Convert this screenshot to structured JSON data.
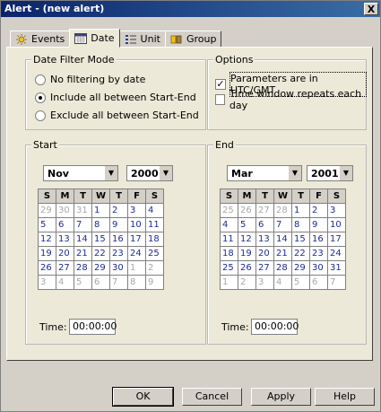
{
  "window": {
    "title": "Alert - (new alert)",
    "close_glyph": "X"
  },
  "tabs": [
    {
      "label": "Events",
      "icon": "events-icon"
    },
    {
      "label": "Date",
      "icon": "calendar-icon"
    },
    {
      "label": "Unit",
      "icon": "unit-icon"
    },
    {
      "label": "Group",
      "icon": "group-icon"
    }
  ],
  "date_filter": {
    "legend": "Date Filter Mode",
    "options": [
      {
        "label": "No filtering by date",
        "checked": false
      },
      {
        "label": "Include all between Start-End",
        "checked": true
      },
      {
        "label": "Exclude all between Start-End",
        "checked": false
      }
    ]
  },
  "options": {
    "legend": "Options",
    "utc": {
      "label": "Parameters are in UTC/GMT",
      "checked": true,
      "mark": "✓"
    },
    "repeat": {
      "label": "Time window repeats each day",
      "checked": false
    }
  },
  "start": {
    "legend": "Start",
    "month": "Nov",
    "year": "2000",
    "time_label": "Time:",
    "time_value": "00:00:00",
    "days_header": [
      "S",
      "M",
      "T",
      "W",
      "T",
      "F",
      "S"
    ],
    "grid": [
      [
        "29",
        "30",
        "31",
        "1",
        "2",
        "3",
        "4"
      ],
      [
        "5",
        "6",
        "7",
        "8",
        "9",
        "10",
        "11"
      ],
      [
        "12",
        "13",
        "14",
        "15",
        "16",
        "17",
        "18"
      ],
      [
        "19",
        "20",
        "21",
        "22",
        "23",
        "24",
        "25"
      ],
      [
        "26",
        "27",
        "28",
        "29",
        "30",
        "1",
        "2"
      ],
      [
        "3",
        "4",
        "5",
        "6",
        "7",
        "8",
        "9"
      ]
    ]
  },
  "end": {
    "legend": "End",
    "month": "Mar",
    "year": "2001",
    "time_label": "Time:",
    "time_value": "00:00:00",
    "days_header": [
      "S",
      "M",
      "T",
      "W",
      "T",
      "F",
      "S"
    ],
    "grid": [
      [
        "25",
        "26",
        "27",
        "28",
        "1",
        "2",
        "3"
      ],
      [
        "4",
        "5",
        "6",
        "7",
        "8",
        "9",
        "10"
      ],
      [
        "11",
        "12",
        "13",
        "14",
        "15",
        "16",
        "17"
      ],
      [
        "18",
        "19",
        "20",
        "21",
        "22",
        "23",
        "24"
      ],
      [
        "25",
        "26",
        "27",
        "28",
        "29",
        "30",
        "31"
      ],
      [
        "1",
        "2",
        "3",
        "4",
        "5",
        "6",
        "7"
      ]
    ]
  },
  "buttons": {
    "ok": "OK",
    "cancel": "Cancel",
    "apply": "Apply",
    "help": "Help"
  },
  "colors": {
    "title_bar": "#0a246a",
    "day_text": "#1a2a99",
    "muted_day": "#a8a8a8",
    "dialog": "#d4d0c8"
  }
}
